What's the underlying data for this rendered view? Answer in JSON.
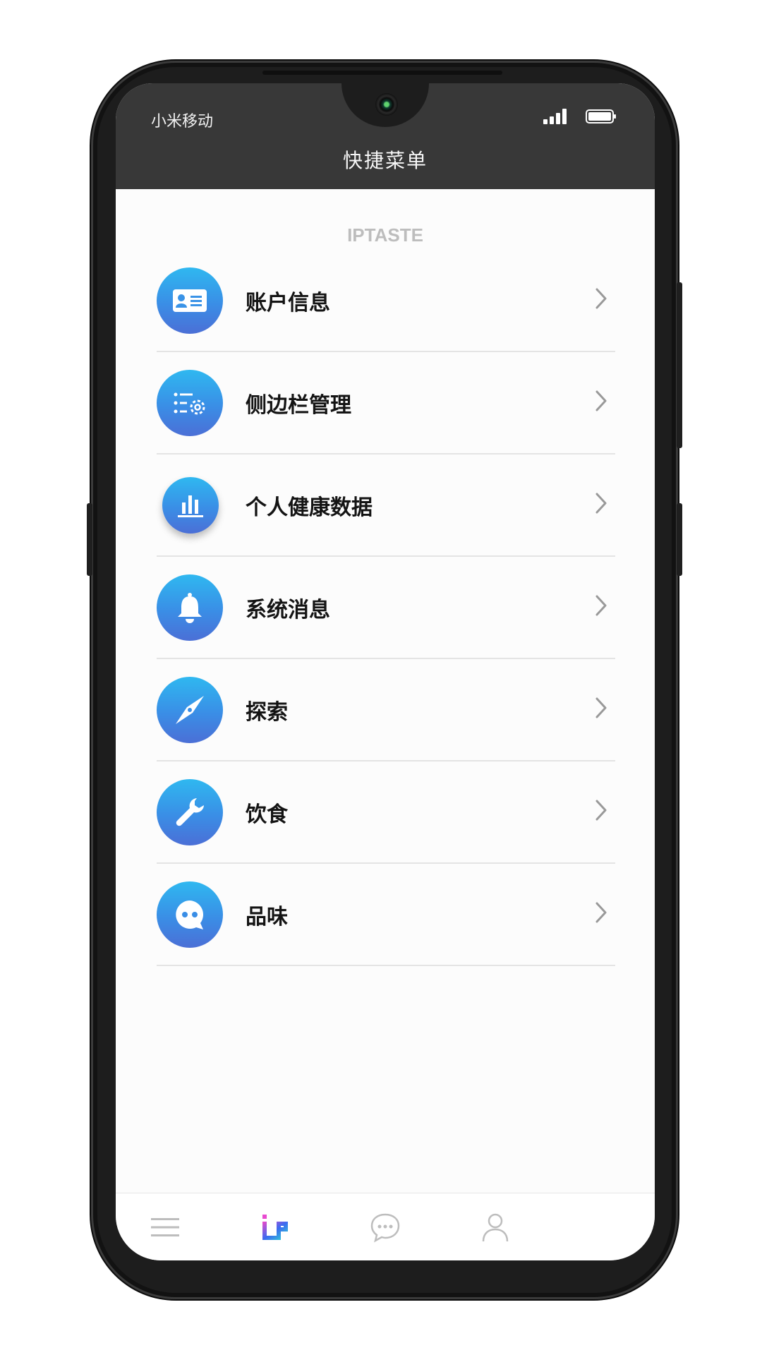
{
  "status_bar": {
    "carrier": "小米移动",
    "signal_icon": "signal-icon",
    "battery_icon": "battery-icon"
  },
  "header": {
    "title": "快捷菜单"
  },
  "brand": "IPTASTE",
  "menu": {
    "items": [
      {
        "label": "账户信息",
        "icon": "id-card-icon"
      },
      {
        "label": "侧边栏管理",
        "icon": "list-settings-icon"
      },
      {
        "label": "个人健康数据",
        "icon": "bar-chart-icon"
      },
      {
        "label": "系统消息",
        "icon": "bell-icon"
      },
      {
        "label": "探索",
        "icon": "compass-icon"
      },
      {
        "label": "饮食",
        "icon": "wrench-icon"
      },
      {
        "label": "品味",
        "icon": "chat-bubble-icon"
      }
    ]
  },
  "tabbar": {
    "tabs": [
      "menu-icon",
      "iptaste-logo-icon",
      "chat-icon",
      "user-icon"
    ],
    "active_index": 1
  },
  "colors": {
    "header_bg": "#383838",
    "icon_gradient_top": "#2fb8f0",
    "icon_gradient_bottom": "#4b6fd6",
    "brand_text": "#bdbdbd"
  }
}
